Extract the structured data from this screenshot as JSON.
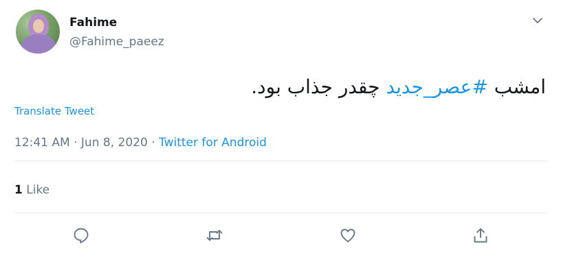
{
  "user": {
    "name": "Fahime",
    "handle": "@Fahime_paeez"
  },
  "tweet": {
    "text_before": "امشب ",
    "hashtag": "#عصر_جدید",
    "text_after": " چقدر جذاب بود."
  },
  "translate_label": "Translate Tweet",
  "meta": {
    "time": "12:41 AM",
    "separator": "·",
    "date": "Jun 8, 2020",
    "source": "Twitter for Android"
  },
  "likes": {
    "count": "1",
    "label": "Like"
  },
  "icons": {
    "reply": "reply-icon",
    "retweet": "retweet-icon",
    "like": "heart-icon",
    "share": "share-icon",
    "menu": "chevron-down-icon"
  },
  "colors": {
    "link": "#1b95e0",
    "secondary_text": "#657786",
    "primary_text": "#14171a",
    "divider": "#e6ecf0"
  }
}
